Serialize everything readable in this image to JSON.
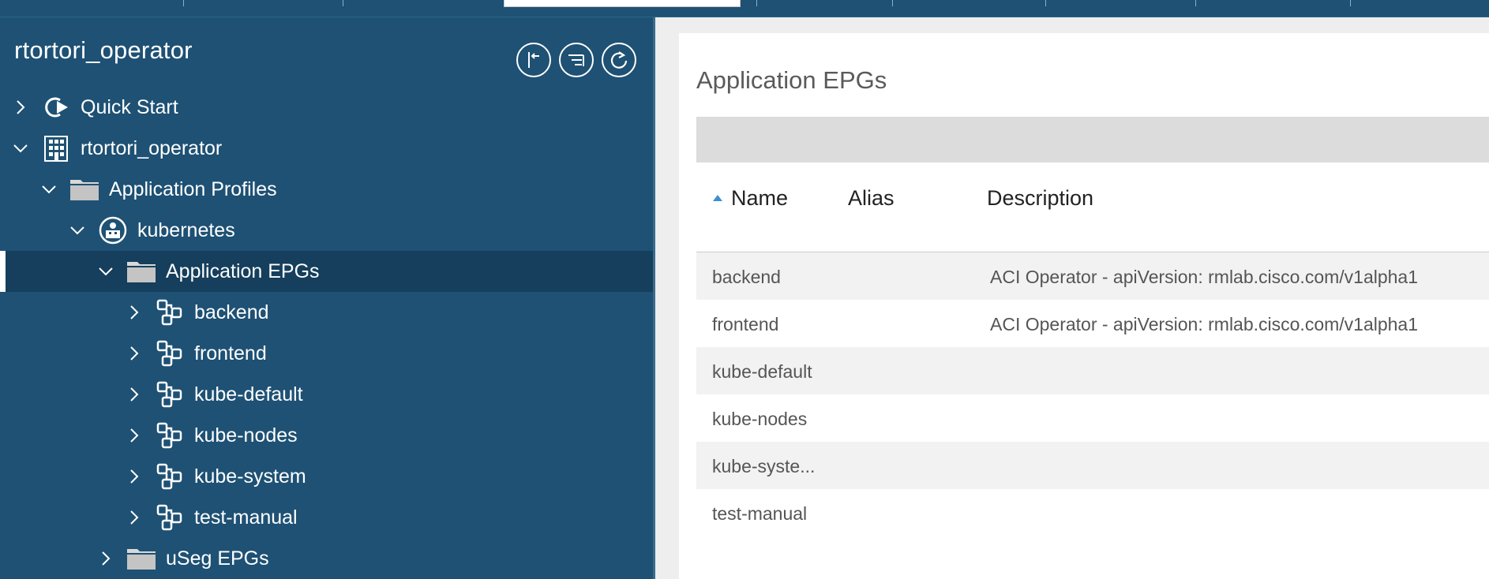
{
  "sidebar": {
    "title": "rtortori_operator",
    "tools": [
      {
        "name": "flag-back-icon"
      },
      {
        "name": "list-filter-icon"
      },
      {
        "name": "refresh-icon"
      }
    ],
    "tree": {
      "quick_start": "Quick Start",
      "tenant": "rtortori_operator",
      "application_profiles": "Application Profiles",
      "profile": "kubernetes",
      "application_epgs": "Application EPGs",
      "epgs": [
        "backend",
        "frontend",
        "kube-default",
        "kube-nodes",
        "kube-system",
        "test-manual"
      ],
      "useg_epgs": "uSeg EPGs"
    }
  },
  "main": {
    "title": "Application EPGs",
    "columns": {
      "name": "Name",
      "alias": "Alias",
      "description": "Description"
    },
    "rows": [
      {
        "name": "backend",
        "alias": "",
        "description": "ACI Operator - apiVersion: rmlab.cisco.com/v1alpha1"
      },
      {
        "name": "frontend",
        "alias": "",
        "description": "ACI Operator - apiVersion: rmlab.cisco.com/v1alpha1"
      },
      {
        "name": "kube-default",
        "alias": "",
        "description": ""
      },
      {
        "name": "kube-nodes",
        "alias": "",
        "description": ""
      },
      {
        "name": "kube-syste...",
        "alias": "",
        "description": ""
      },
      {
        "name": "test-manual",
        "alias": "",
        "description": ""
      }
    ]
  },
  "colors": {
    "sidebar_bg": "#1e5174",
    "selected_bg": "#153f5c",
    "sort_arrow": "#3d8fd0"
  }
}
